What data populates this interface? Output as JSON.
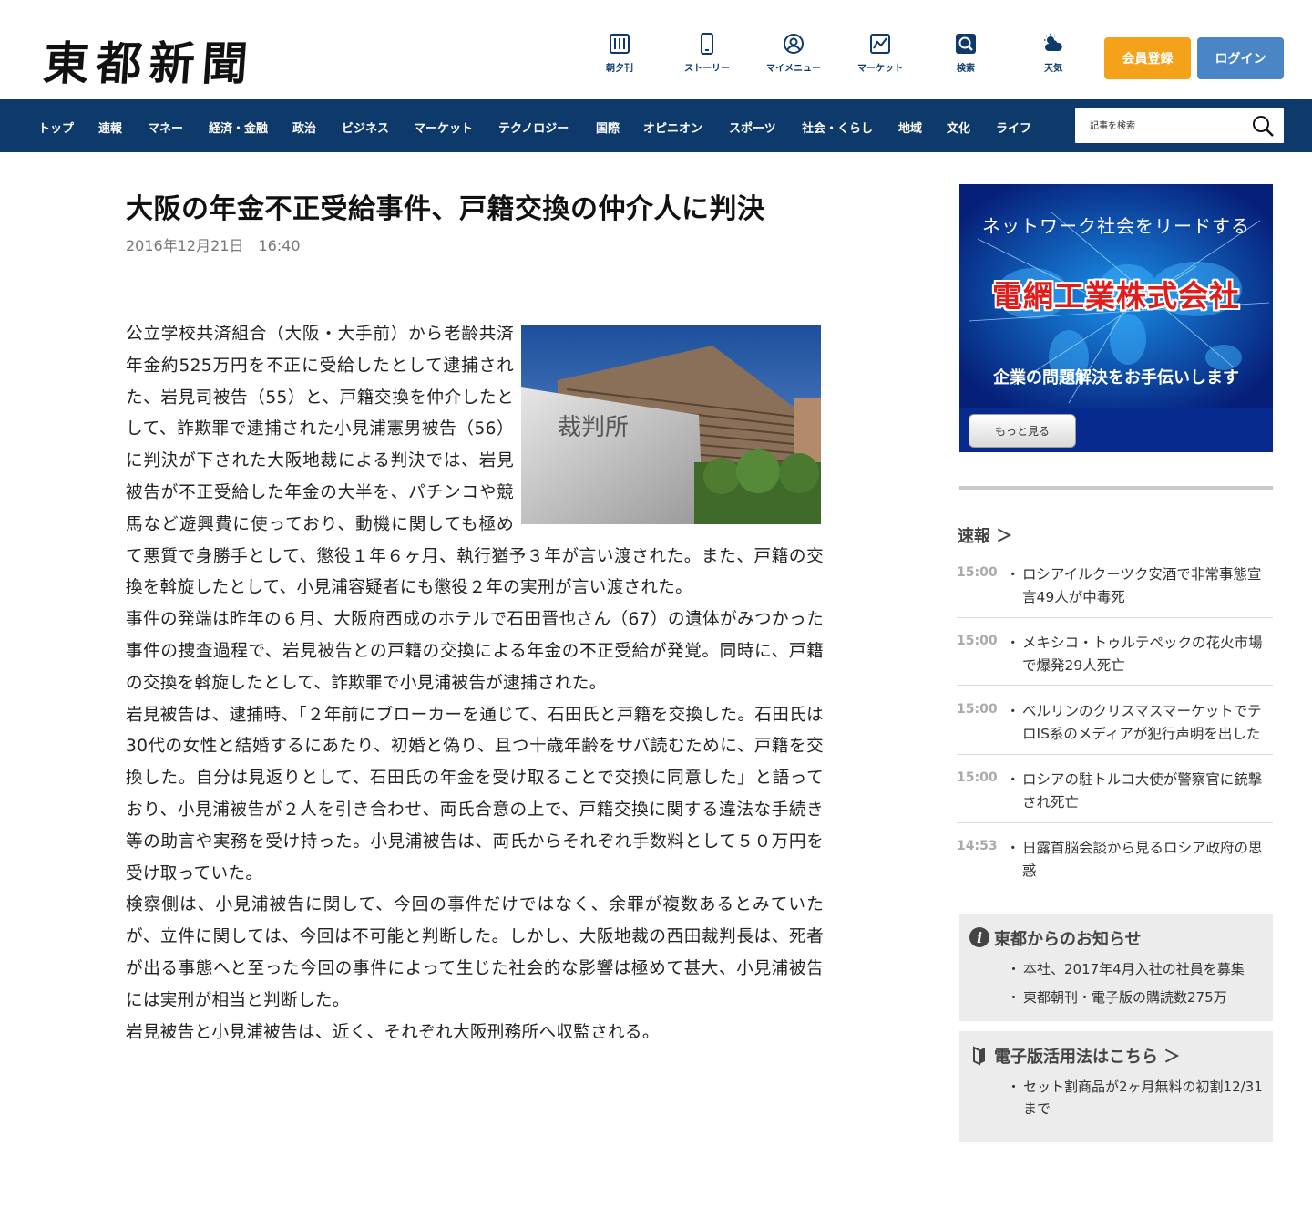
{
  "header": {
    "logo": "東都新聞",
    "nav": [
      {
        "label": "朝夕刊",
        "icon": "newspaper-icon"
      },
      {
        "label": "ストーリー",
        "icon": "smartphone-icon"
      },
      {
        "label": "マイメニュー",
        "icon": "user-icon"
      },
      {
        "label": "マーケット",
        "icon": "chart-icon"
      },
      {
        "label": "検索",
        "icon": "search-icon"
      },
      {
        "label": "天気",
        "icon": "weather-icon"
      }
    ],
    "register_label": "会員登録",
    "login_label": "ログイン"
  },
  "navbar": {
    "items": [
      "トップ",
      "速報",
      "マネー",
      "経済・金融",
      "政治",
      "ビジネス",
      "マーケット",
      "テクノロジー",
      "国際",
      "オピニオン",
      "スポーツ",
      "社会・くらし",
      "地域",
      "文化",
      "ライフ"
    ],
    "search_placeholder": "記事を検索"
  },
  "article": {
    "title": "大阪の年金不正受給事件、戸籍交換の仲介人に判決",
    "date": "2016年12月21日　16:40",
    "photo_caption": "裁判所",
    "paragraphs": [
      "公立学校共済組合（大阪・大手前）から老齢共済年金約525万円を不正に受給したとして逮捕された、岩見司被告（55）と、戸籍交換を仲介したとして、詐欺罪で逮捕された小見浦憲男被告（56）に判決が下された大阪地裁による判決では、岩見被告が不正受給した年金の大半を、パチンコや競馬など遊興費に使っており、動機に関しても極めて悪質で身勝手として、懲役１年６ヶ月、執行猶予３年が言い渡された。また、戸籍の交換を斡旋したとして、小見浦容疑者にも懲役２年の実刑が言い渡された。",
      "事件の発端は昨年の６月、大阪府西成のホテルで石田晋也さん（67）の遺体がみつかった事件の捜査過程で、岩見被告との戸籍の交換による年金の不正受給が発覚。同時に、戸籍の交換を斡旋したとして、詐欺罪で小見浦被告が逮捕された。",
      "岩見被告は、逮捕時、「２年前にブローカーを通じて、石田氏と戸籍を交換した。石田氏は30代の女性と結婚するにあたり、初婚と偽り、且つ十歳年齢をサバ読むために、戸籍を交換した。自分は見返りとして、石田氏の年金を受け取ることで交換に同意した」と語っており、小見浦被告が２人を引き合わせ、両氏合意の上で、戸籍交換に関する違法な手続き等の助言や実務を受け持った。小見浦被告は、両氏からそれぞれ手数料として５０万円を受け取っていた。",
      "検察側は、小見浦被告に関して、今回の事件だけではなく、余罪が複数あるとみていたが、立件に関しては、今回は不可能と判断した。しかし、大阪地裁の西田裁判長は、死者が出る事態へと至った今回の事件によって生じた社会的な影響は極めて甚大、小見浦被告には実刑が相当と判断した。",
      "岩見被告と小見浦被告は、近く、それぞれ大阪刑務所へ収監される。"
    ]
  },
  "ad": {
    "line1": "ネットワーク社会をリードする",
    "company": "電網工業株式会社",
    "line3": "企業の問題解決をお手伝いします",
    "more_label": "もっと見る"
  },
  "news": {
    "heading": "速報 ＞",
    "items": [
      {
        "time": "15:00",
        "text": "ロシアイルクーツク安酒で非常事態宣言49人が中毒死"
      },
      {
        "time": "15:00",
        "text": "メキシコ・トゥルテペックの花火市場で爆発29人死亡"
      },
      {
        "time": "15:00",
        "text": "ベルリンのクリスマスマーケットでテロIS系のメディアが犯行声明を出した"
      },
      {
        "time": "15:00",
        "text": "ロシアの駐トルコ大使が警察官に銃撃され死亡"
      },
      {
        "time": "14:53",
        "text": "日露首脳会談から見るロシア政府の思惑"
      }
    ]
  },
  "notice": {
    "heading": "東都からのお知らせ",
    "items": [
      "本社、2017年4月入社の社員を募集",
      "東都朝刊・電子版の購読数275万"
    ]
  },
  "guide": {
    "heading": "電子版活用法はこちら ＞",
    "items": [
      "セット割商品が2ヶ月無料の初割12/31まで"
    ]
  },
  "colors": {
    "navy": "#0e3a6b",
    "orange": "#f5a21b",
    "blue": "#4a86c5"
  }
}
